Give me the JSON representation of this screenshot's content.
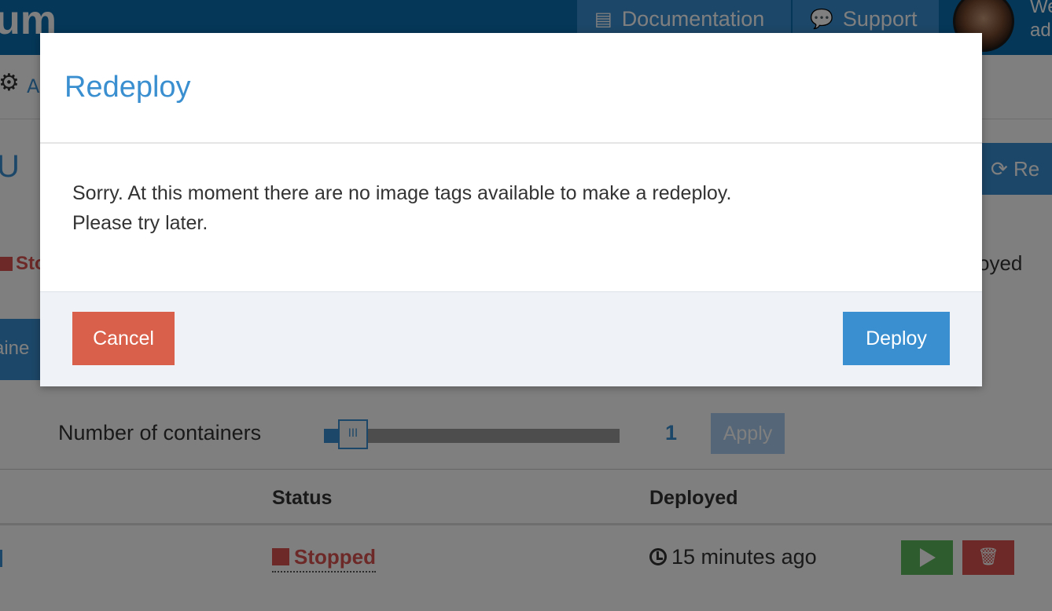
{
  "navbar": {
    "brand_fragment": "um",
    "documentation_label": "Documentation",
    "support_label": "Support",
    "welcome_line1": "We",
    "welcome_line2": "ad"
  },
  "background": {
    "subbar_fragment": "A",
    "title_fragment": "U",
    "redeploy_fragment": "Re",
    "status_top": "Sto",
    "deployed_top": "oyed",
    "containers_tab_fragment": "aine",
    "scale_label": "Number of containers",
    "scale_value": "1",
    "apply_label": "Apply",
    "table": {
      "headers": {
        "status": "Status",
        "deployed": "Deployed"
      },
      "row": {
        "status": "Stopped",
        "deployed": "15 minutes ago"
      }
    }
  },
  "modal": {
    "title": "Redeploy",
    "message_line1": "Sorry. At this moment there are no image tags available to make a redeploy.",
    "message_line2": "Please try later.",
    "cancel_label": "Cancel",
    "deploy_label": "Deploy"
  },
  "colors": {
    "primary": "#3a8fd0",
    "danger": "#d9604a",
    "success": "#5cb85c",
    "footer_bg": "#eff2f6"
  }
}
